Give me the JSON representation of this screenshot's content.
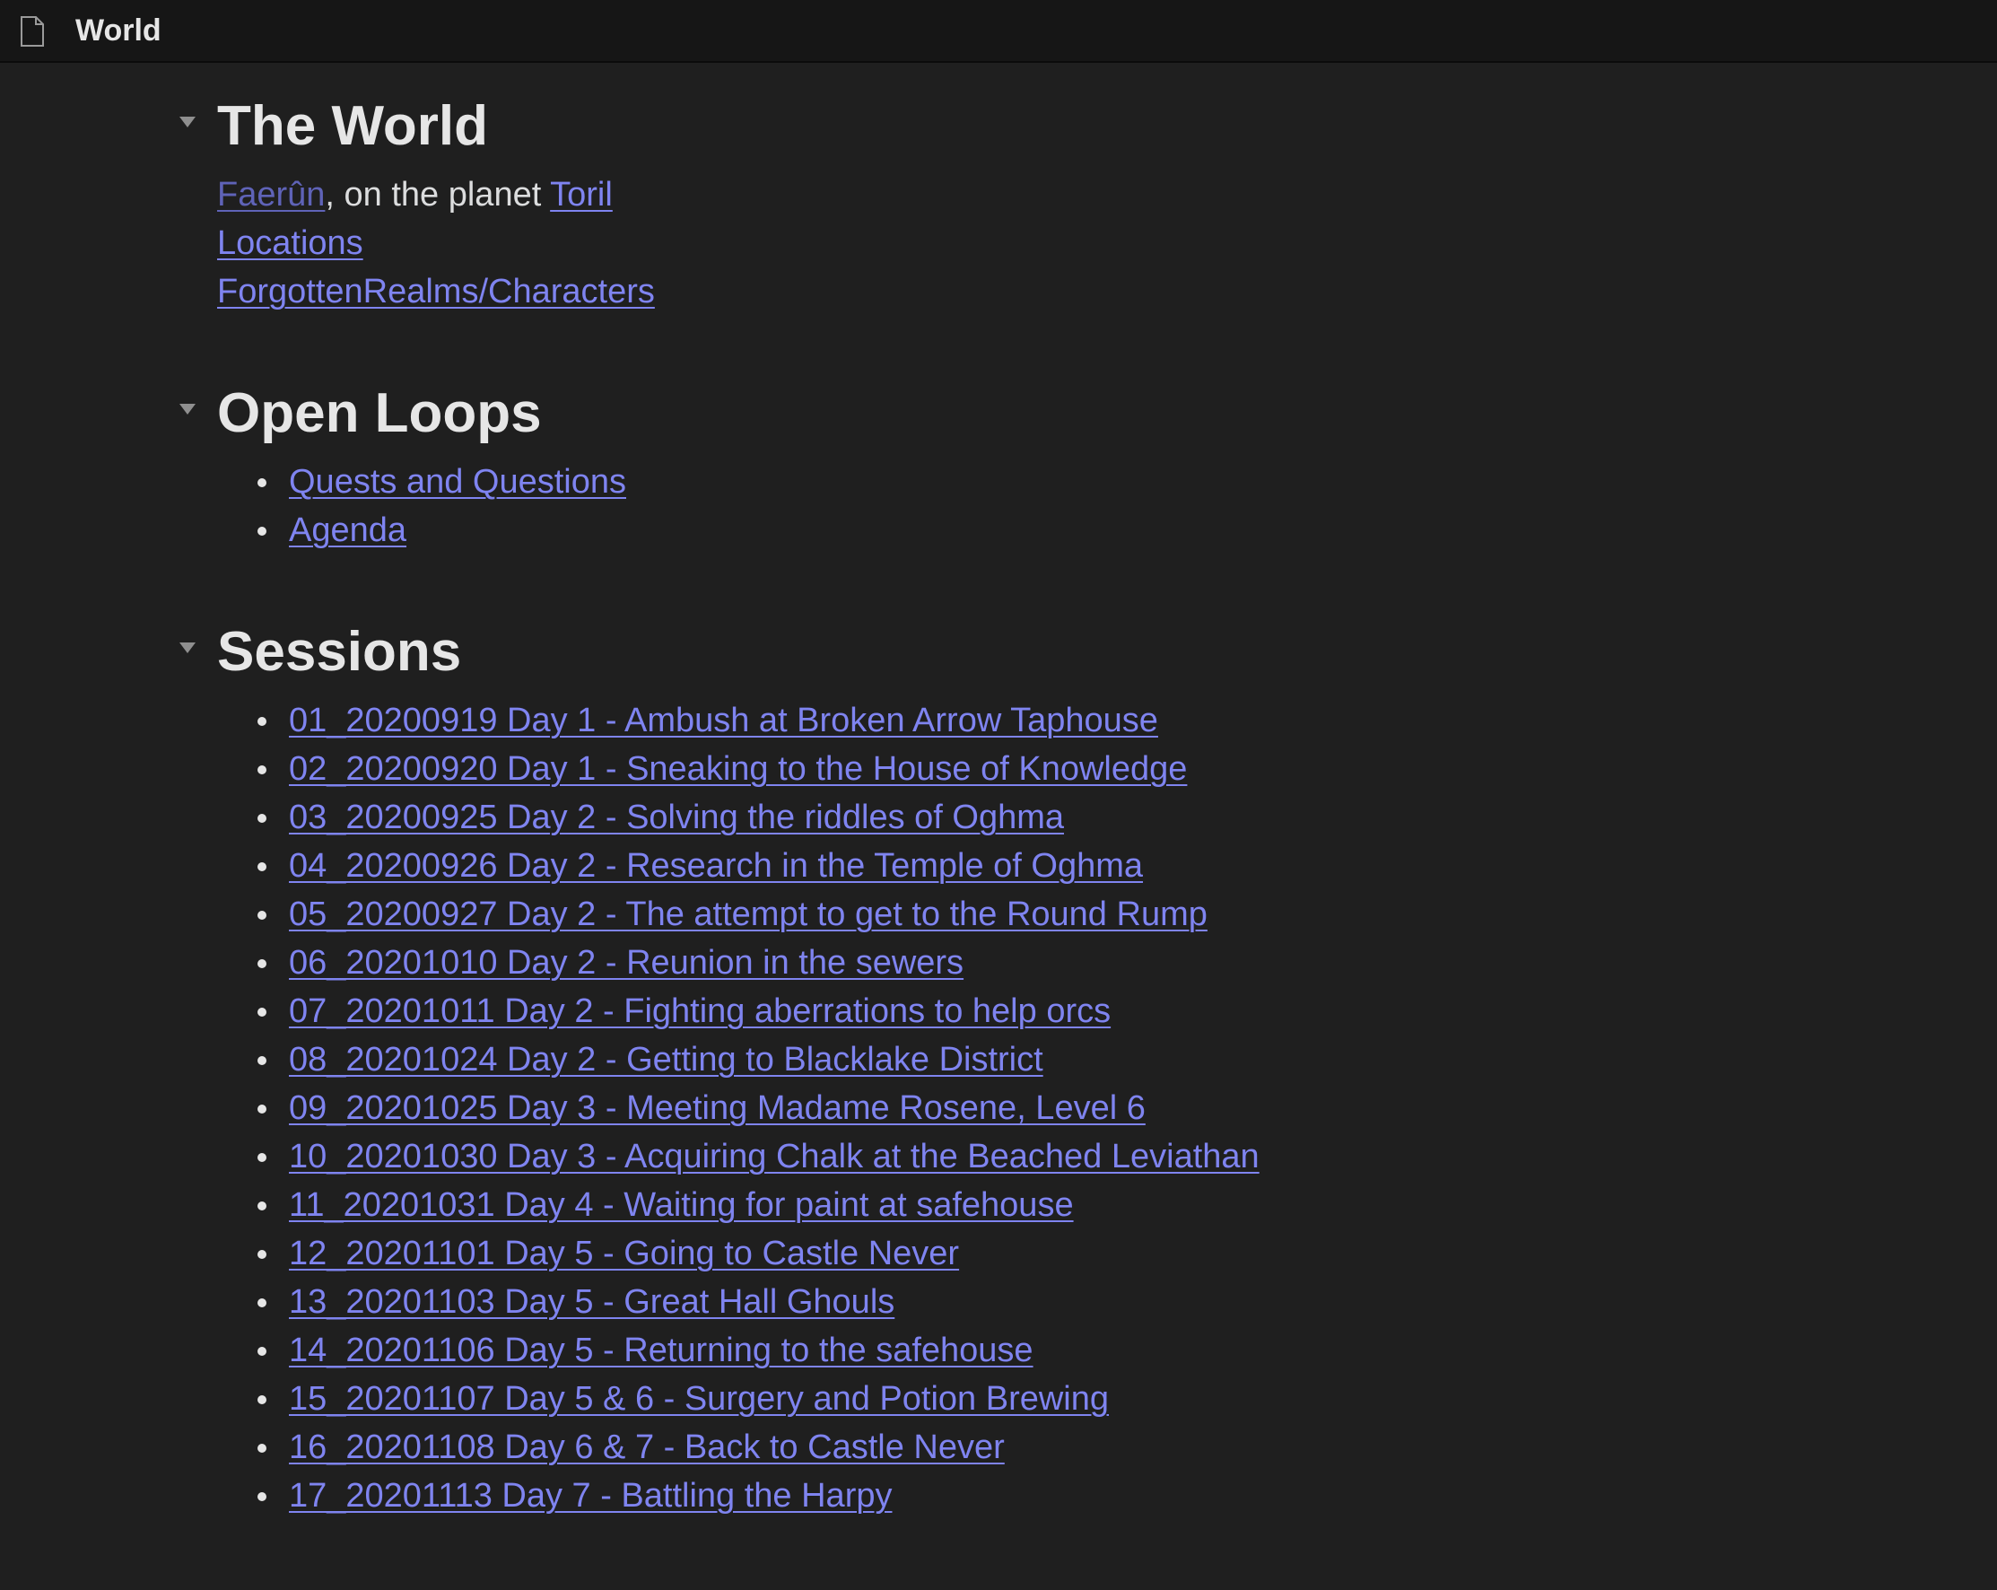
{
  "window": {
    "title": "World",
    "icon": "file-icon"
  },
  "world": {
    "heading": "The World",
    "line1": {
      "link1": "Faerûn",
      "text": ", on the planet ",
      "link2": "Toril"
    },
    "locations_link": "Locations",
    "characters_link": "ForgottenRealms/Characters"
  },
  "open_loops": {
    "heading": "Open Loops",
    "items": [
      "Quests and Questions",
      "Agenda"
    ]
  },
  "sessions": {
    "heading": "Sessions",
    "items": [
      "01_20200919 Day 1 - Ambush at Broken Arrow Taphouse",
      "02_20200920 Day 1 - Sneaking to the House of Knowledge",
      "03_20200925 Day 2 - Solving the riddles of Oghma",
      "04_20200926 Day 2 - Research in the Temple of Oghma",
      "05_20200927 Day 2 - The attempt to get to the Round Rump",
      "06_20201010 Day 2 - Reunion in the sewers",
      "07_20201011 Day 2 - Fighting aberrations to help orcs",
      "08_20201024 Day 2 - Getting to Blacklake District",
      "09_20201025 Day 3 - Meeting Madame Rosene, Level 6",
      "10_20201030 Day 3 - Acquiring Chalk at the Beached Leviathan",
      "11_20201031 Day 4 - Waiting for paint at safehouse",
      "12_20201101 Day 5 - Going to Castle Never",
      "13_20201103 Day 5 - Great Hall Ghouls",
      "14_20201106 Day 5 - Returning to the safehouse",
      "15_20201107 Day 5 & 6 - Surgery and Potion Brewing",
      "16_20201108 Day 6 & 7 - Back to Castle Never",
      "17_20201113 Day 7 - Battling the Harpy"
    ]
  },
  "colors": {
    "background": "#1f1f1f",
    "titlebar": "#161616",
    "link": "#7f84f0",
    "text": "#dcddde"
  }
}
